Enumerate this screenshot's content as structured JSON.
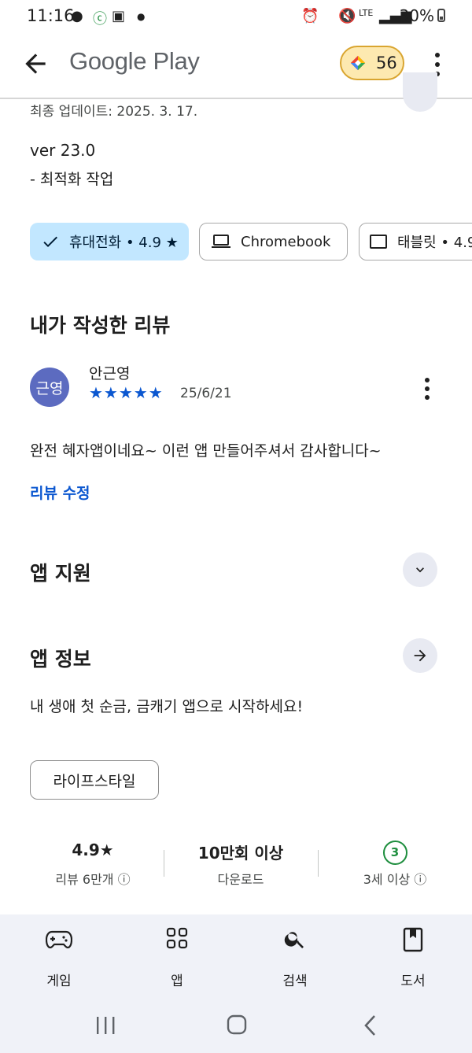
{
  "status_bar": {
    "time": "11:16",
    "battery": "30%",
    "network": "LTE"
  },
  "header": {
    "title": "Google Play",
    "points": "56"
  },
  "update": {
    "last_updated": "최종 업데이트: 2025. 3. 17.",
    "version": "ver 23.0",
    "notes": "- 최적화 작업"
  },
  "device_chips": [
    {
      "label": "휴대전화 • 4.9 ★"
    },
    {
      "label": "Chromebook"
    },
    {
      "label": "태블릿 • 4.9"
    }
  ],
  "my_review": {
    "section_title": "내가 작성한 리뷰",
    "avatar_text": "근영",
    "author": "안근영",
    "stars": "★★★★★",
    "date": "25/6/21",
    "text": "완전 혜자앱이네요~ 이런 앱 만들어주셔서 감사합니다~",
    "edit_label": "리뷰 수정"
  },
  "app_support": {
    "title": "앱 지원"
  },
  "app_info": {
    "title": "앱 정보",
    "description": "내 생애 첫 순금, 금캐기 앱으로 시작하세요!",
    "category": "라이프스타일"
  },
  "stats": {
    "rating": "4.9★",
    "reviews": "리뷰 6만개 ⓘ",
    "downloads": "10만회 이상",
    "downloads_label": "다운로드",
    "age_badge": "3",
    "age_label": "3세 이상 ⓘ"
  },
  "bottom_nav": [
    {
      "label": "게임"
    },
    {
      "label": "앱"
    },
    {
      "label": "검색"
    },
    {
      "label": "도서"
    }
  ],
  "colors": {
    "accent": "#0b57d0",
    "chip_selected": "#c2e7ff",
    "avatar": "#5c6bc0",
    "age_green": "#1e8e3e"
  }
}
